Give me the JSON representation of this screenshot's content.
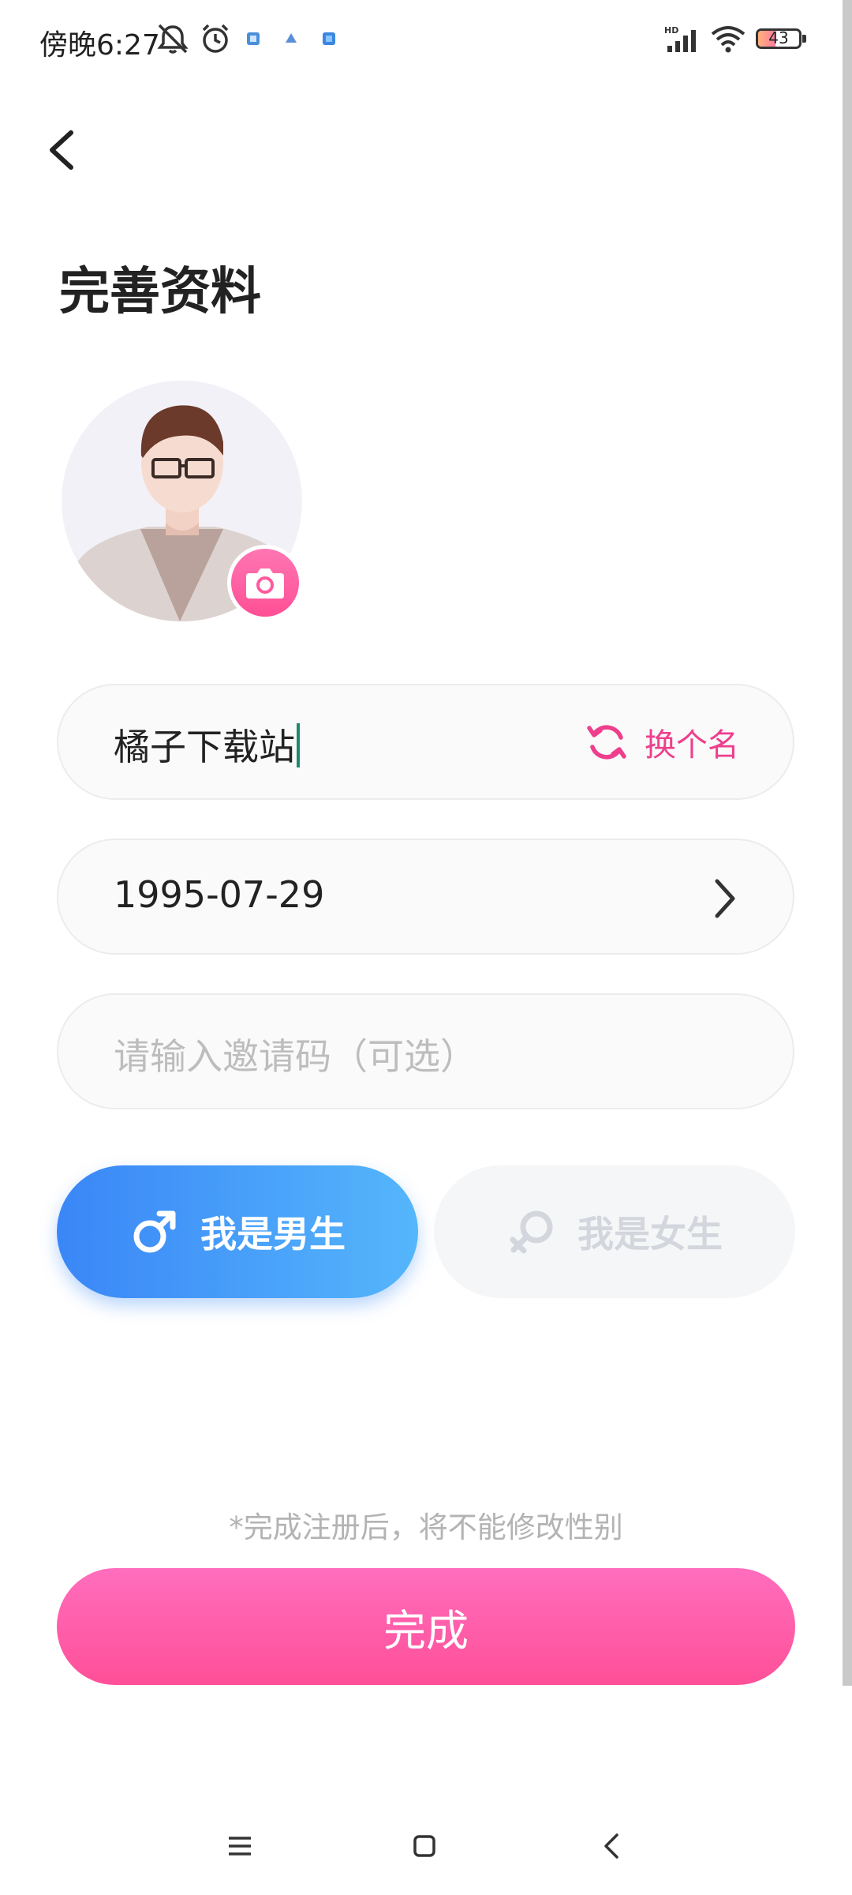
{
  "status_bar": {
    "time": "傍晚6:27",
    "battery": "43",
    "icons": [
      "mute-icon",
      "alarm-icon",
      "app-notification-icon",
      "signal-hd-icon",
      "wifi-icon",
      "battery-icon"
    ]
  },
  "header": {
    "back_icon": "chevron-left-icon",
    "title": "完善资料"
  },
  "avatar": {
    "camera_icon": "camera-icon"
  },
  "form": {
    "nickname": "橘子下载站",
    "rename_label": "换个名",
    "birthday": "1995-07-29",
    "invite_placeholder": "请输入邀请码（可选）"
  },
  "gender": {
    "male_label": "我是男生",
    "female_label": "我是女生",
    "selected": "male"
  },
  "footer": {
    "notice": "*完成注册后，将不能修改性别",
    "submit_label": "完成"
  },
  "nav_bar": {
    "icons": [
      "menu-icon",
      "home-icon",
      "back-icon"
    ]
  },
  "colors": {
    "accent_pink": "#ff4f98",
    "male_blue": "#3a86f7"
  }
}
